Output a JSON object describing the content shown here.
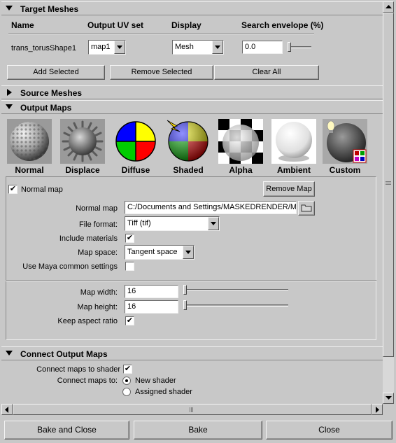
{
  "target_meshes": {
    "header": "Target Meshes",
    "columns": [
      "Name",
      "Output UV set",
      "Display",
      "Search envelope (%)"
    ],
    "row": {
      "name": "trans_torusShape1",
      "uv_set": "map1",
      "display": "Mesh",
      "envelope": "0.0"
    },
    "buttons": {
      "add": "Add Selected",
      "remove": "Remove Selected",
      "clear": "Clear All"
    }
  },
  "source_meshes": {
    "header": "Source Meshes"
  },
  "output_maps": {
    "header": "Output Maps",
    "types": [
      "Normal",
      "Displace",
      "Diffuse",
      "Shaded",
      "Alpha",
      "Ambient",
      "Custom"
    ],
    "normal_map_checkbox_label": "Normal map",
    "normal_map_checked": true,
    "remove_map": "Remove Map",
    "fields": {
      "normal_map_label": "Normal map",
      "normal_map_path": "C:/Documents and Settings/MASKEDRENDER/M",
      "file_format_label": "File format:",
      "file_format": "Tiff (tif)",
      "include_materials_label": "Include materials",
      "include_materials": true,
      "map_space_label": "Map space:",
      "map_space": "Tangent space",
      "use_maya_label": "Use Maya common settings",
      "use_maya": false,
      "map_width_label": "Map width:",
      "map_width": "16",
      "map_height_label": "Map height:",
      "map_height": "16",
      "keep_aspect_label": "Keep aspect ratio",
      "keep_aspect": true
    }
  },
  "connect_output_maps": {
    "header": "Connect Output Maps",
    "connect_to_shader_label": "Connect maps to shader",
    "connect_to_shader": true,
    "connect_to_label": "Connect maps to:",
    "options": [
      "New shader",
      "Assigned shader"
    ],
    "selected_option": "New shader"
  },
  "bottom_buttons": {
    "bake_close": "Bake and Close",
    "bake": "Bake",
    "close": "Close"
  },
  "icons": {
    "check": "✔",
    "folder": "folder-icon"
  }
}
